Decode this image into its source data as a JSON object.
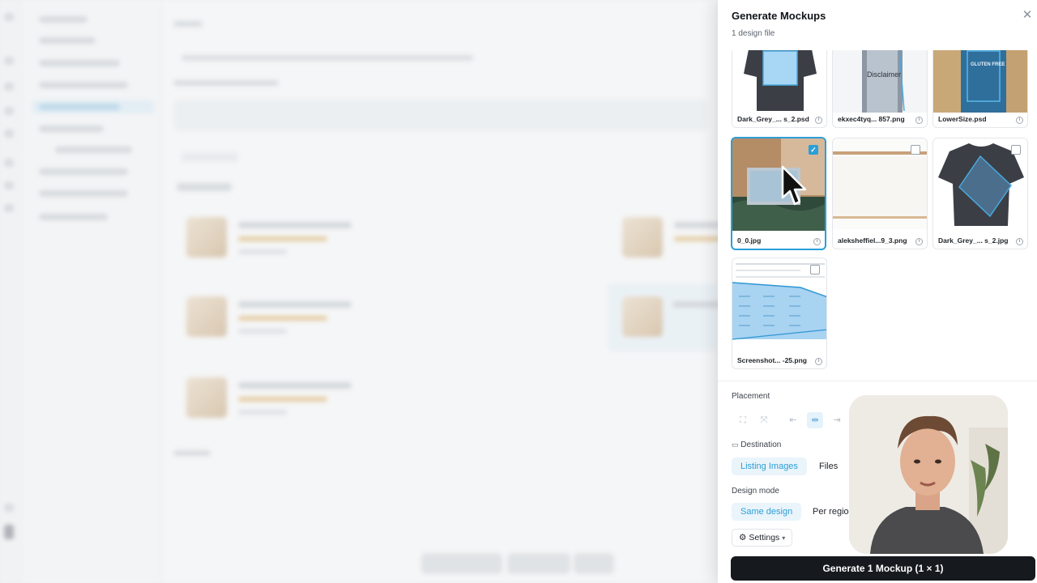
{
  "panel": {
    "title": "Generate Mockups",
    "subtitle": "1 design file",
    "close_icon": "close-icon"
  },
  "mockups": [
    {
      "name": "Dark_Grey_... s_2.psd",
      "checked": false,
      "visible": "partial"
    },
    {
      "name": "ekxec4tyq... 857.png",
      "checked": false,
      "visible": "partial",
      "overlay_text": "Disclaimer"
    },
    {
      "name": "LowerSize.psd",
      "checked": false,
      "visible": "partial",
      "overlay_text": "GLUTEN FREE"
    },
    {
      "name": "0_0.jpg",
      "checked": true,
      "visible": "full"
    },
    {
      "name": "aleksheffiel...9_3.png",
      "checked": false,
      "visible": "full"
    },
    {
      "name": "Dark_Grey_... s_2.jpg",
      "checked": false,
      "visible": "full"
    },
    {
      "name": "Screenshot... -25.png",
      "checked": false,
      "visible": "full"
    }
  ],
  "placement": {
    "label": "Placement",
    "buttons": [
      "fit-icon",
      "fill-icon",
      "align-left-icon",
      "align-center-icon",
      "align-right-icon"
    ],
    "active": "align-center-icon"
  },
  "destination": {
    "label": "Destination",
    "options": [
      "Listing Images",
      "Files"
    ],
    "selected": "Listing Images"
  },
  "design_mode": {
    "label": "Design mode",
    "options": [
      "Same design",
      "Per regio"
    ],
    "selected": "Same design"
  },
  "settings": {
    "label": "Settings"
  },
  "generate": {
    "label": "Generate 1 Mockup (1 × 1)"
  },
  "colors": {
    "accent": "#2b9fd8",
    "primary_button": "#161a1f"
  }
}
